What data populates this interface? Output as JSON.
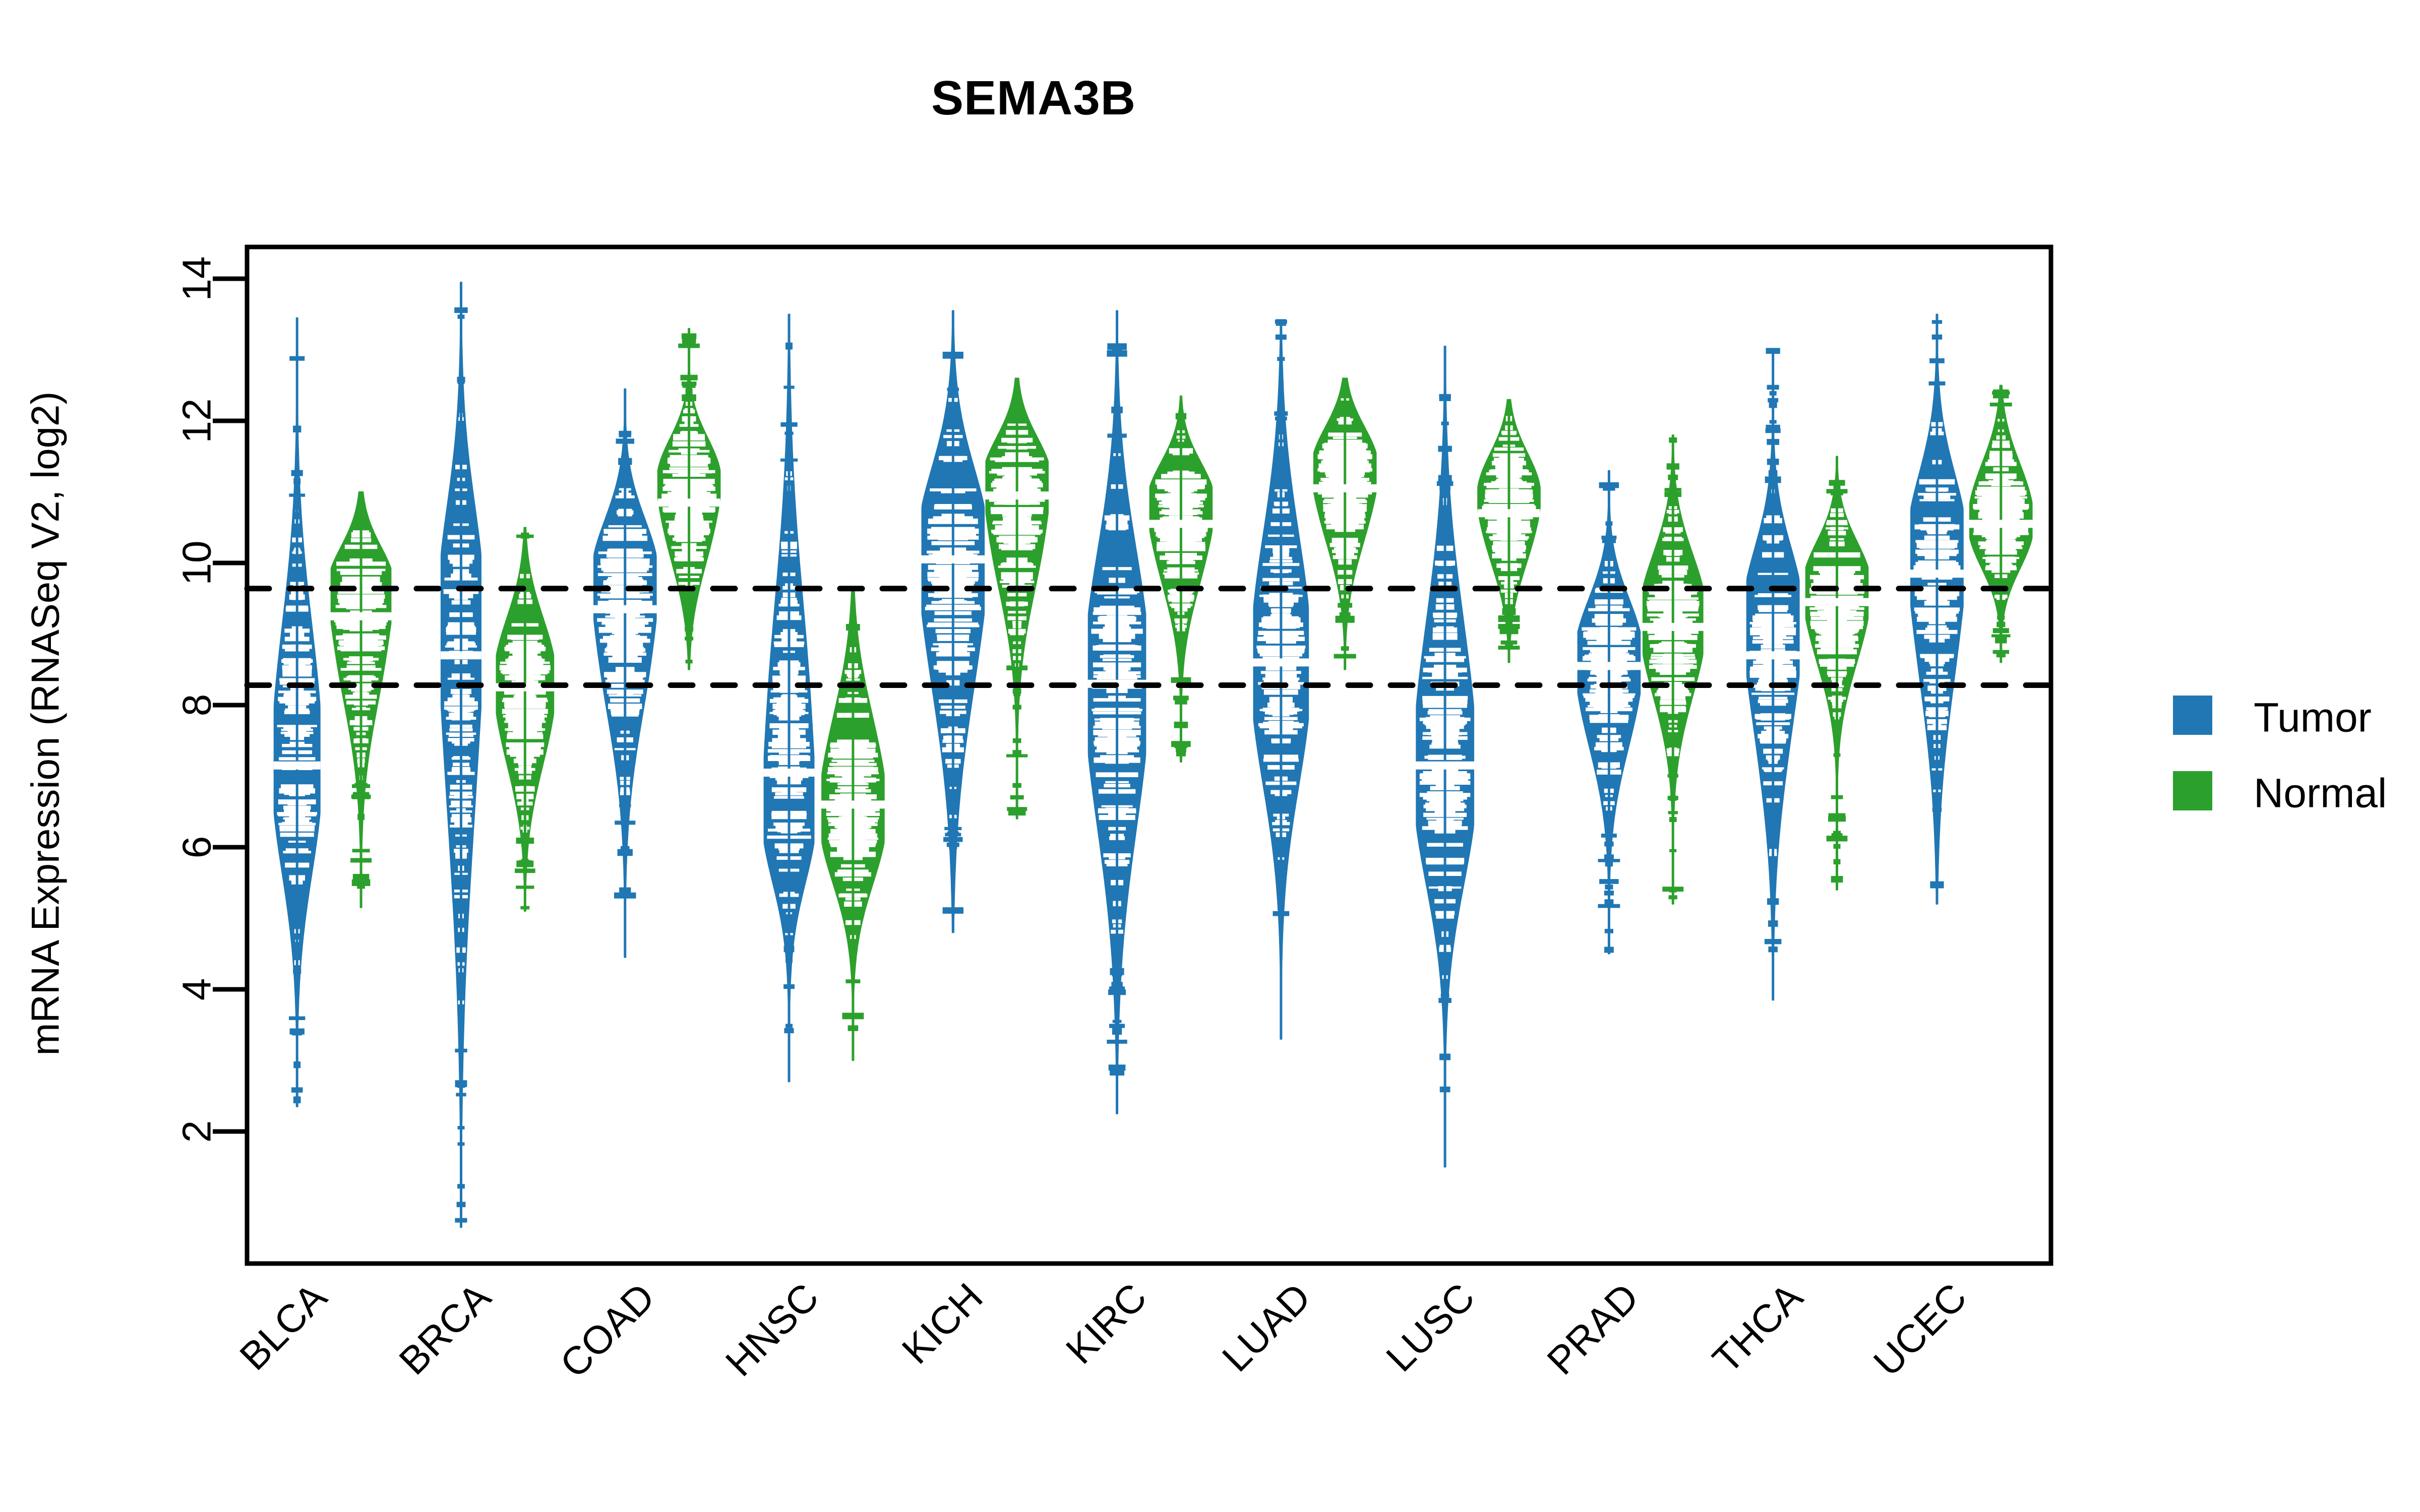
{
  "chart_data": {
    "type": "violin",
    "title": "SEMA3B",
    "xlabel": "",
    "ylabel": "mRNA Expression (RNASeq V2, log2)",
    "ylim": [
      0,
      14.6
    ],
    "yticks": [
      2,
      4,
      6,
      8,
      10,
      12,
      14
    ],
    "ytick_labels": [
      "2",
      "4",
      "6",
      "8",
      "10",
      "12",
      "14"
    ],
    "grid": false,
    "legend_position": "right",
    "reference_lines": [
      9.64,
      8.28
    ],
    "categories": [
      "BLCA",
      "BRCA",
      "COAD",
      "HNSC",
      "KICH",
      "KIRC",
      "LUAD",
      "LUSC",
      "PRAD",
      "THCA",
      "UCEC"
    ],
    "legend": [
      {
        "name": "Tumor",
        "color": "#2077B4"
      },
      {
        "name": "Normal",
        "color": "#2CA02C"
      }
    ],
    "series": [
      {
        "name": "Tumor",
        "color": "#2077B4",
        "groups": [
          {
            "category": "BLCA",
            "median": 7.15,
            "q1": 6.3,
            "q3": 8.4,
            "min": 2.35,
            "max": 13.45,
            "lower": 4.2,
            "upper": 11.0,
            "peak": 7.2,
            "width": 0.92,
            "seed": 11
          },
          {
            "category": "BRCA",
            "median": 8.7,
            "q1": 7.6,
            "q3": 9.7,
            "min": 0.65,
            "max": 13.95,
            "lower": 3.3,
            "upper": 12.4,
            "peak": 9.3,
            "width": 0.8,
            "seed": 23
          },
          {
            "category": "COAD",
            "median": 9.35,
            "q1": 8.5,
            "q3": 10.2,
            "min": 4.45,
            "max": 12.45,
            "lower": 6.5,
            "upper": 11.4,
            "peak": 9.7,
            "width": 1.25,
            "seed": 31
          },
          {
            "category": "HNSC",
            "median": 7.05,
            "q1": 6.0,
            "q3": 8.3,
            "min": 2.7,
            "max": 13.5,
            "lower": 4.6,
            "upper": 11.6,
            "peak": 6.6,
            "width": 1.0,
            "seed": 47
          },
          {
            "category": "KICH",
            "median": 10.05,
            "q1": 9.3,
            "q3": 10.7,
            "min": 4.8,
            "max": 13.55,
            "lower": 6.0,
            "upper": 12.4,
            "peak": 10.1,
            "width": 1.4,
            "seed": 53
          },
          {
            "category": "KIRC",
            "median": 8.3,
            "q1": 7.3,
            "q3": 9.3,
            "min": 2.25,
            "max": 13.55,
            "lower": 4.0,
            "upper": 12.0,
            "peak": 8.3,
            "width": 1.15,
            "seed": 61
          },
          {
            "category": "LUAD",
            "median": 8.6,
            "q1": 7.5,
            "q3": 9.6,
            "min": 3.3,
            "max": 13.4,
            "lower": 5.3,
            "upper": 12.2,
            "peak": 8.6,
            "width": 1.1,
            "seed": 73
          },
          {
            "category": "LUSC",
            "median": 7.15,
            "q1": 6.2,
            "q3": 8.3,
            "min": 1.5,
            "max": 13.05,
            "lower": 4.0,
            "upper": 11.3,
            "peak": 7.1,
            "width": 1.15,
            "seed": 83
          },
          {
            "category": "PRAD",
            "median": 8.55,
            "q1": 8.0,
            "q3": 9.2,
            "min": 4.5,
            "max": 11.3,
            "lower": 6.2,
            "upper": 10.2,
            "peak": 8.6,
            "width": 1.35,
            "seed": 97
          },
          {
            "category": "THCA",
            "median": 8.7,
            "q1": 8.1,
            "q3": 9.4,
            "min": 3.85,
            "max": 13.0,
            "lower": 5.6,
            "upper": 11.3,
            "peak": 9.3,
            "width": 1.05,
            "seed": 101
          },
          {
            "category": "UCEC",
            "median": 9.85,
            "q1": 9.1,
            "q3": 10.6,
            "min": 5.2,
            "max": 13.5,
            "lower": 6.4,
            "upper": 12.3,
            "peak": 10.2,
            "width": 1.05,
            "seed": 109
          }
        ]
      },
      {
        "name": "Normal",
        "color": "#2CA02C",
        "groups": [
          {
            "category": "BLCA",
            "median": 9.25,
            "q1": 8.7,
            "q3": 9.9,
            "min": 5.15,
            "max": 11.0,
            "lower": 6.8,
            "upper": 10.6,
            "peak": 9.6,
            "width": 1.2,
            "seed": 13
          },
          {
            "category": "BRCA",
            "median": 8.25,
            "q1": 7.6,
            "q3": 8.9,
            "min": 5.1,
            "max": 10.5,
            "lower": 6.1,
            "upper": 10.0,
            "peak": 8.3,
            "width": 1.15,
            "seed": 29
          },
          {
            "category": "COAD",
            "median": 10.85,
            "q1": 10.2,
            "q3": 11.5,
            "min": 8.5,
            "max": 13.3,
            "lower": 9.3,
            "upper": 12.3,
            "peak": 11.1,
            "width": 1.35,
            "seed": 37
          },
          {
            "category": "HNSC",
            "median": 6.6,
            "q1": 6.0,
            "q3": 7.5,
            "min": 3.0,
            "max": 9.6,
            "lower": 4.5,
            "upper": 9.0,
            "peak": 6.5,
            "width": 1.25,
            "seed": 43
          },
          {
            "category": "KICH",
            "median": 10.95,
            "q1": 10.3,
            "q3": 11.5,
            "min": 6.4,
            "max": 12.6,
            "lower": 8.4,
            "upper": 12.2,
            "peak": 11.1,
            "width": 1.4,
            "seed": 59
          },
          {
            "category": "KIRC",
            "median": 10.55,
            "q1": 10.0,
            "q3": 11.1,
            "min": 7.2,
            "max": 12.35,
            "lower": 8.8,
            "upper": 11.9,
            "peak": 10.8,
            "width": 1.35,
            "seed": 67
          },
          {
            "category": "LUAD",
            "median": 11.05,
            "q1": 10.5,
            "q3": 11.6,
            "min": 8.5,
            "max": 12.6,
            "lower": 9.5,
            "upper": 12.3,
            "peak": 11.3,
            "width": 1.3,
            "seed": 79
          },
          {
            "category": "LUSC",
            "median": 10.7,
            "q1": 10.1,
            "q3": 11.3,
            "min": 8.6,
            "max": 12.3,
            "lower": 9.4,
            "upper": 12.0,
            "peak": 10.9,
            "width": 1.3,
            "seed": 89
          },
          {
            "category": "PRAD",
            "median": 9.1,
            "q1": 8.6,
            "q3": 9.7,
            "min": 5.2,
            "max": 11.8,
            "lower": 7.0,
            "upper": 11.0,
            "peak": 9.2,
            "width": 1.2,
            "seed": 103
          },
          {
            "category": "THCA",
            "median": 9.45,
            "q1": 9.0,
            "q3": 10.0,
            "min": 5.4,
            "max": 11.5,
            "lower": 7.6,
            "upper": 10.9,
            "peak": 9.6,
            "width": 1.25,
            "seed": 107
          },
          {
            "category": "UCEC",
            "median": 10.55,
            "q1": 10.1,
            "q3": 11.1,
            "min": 8.6,
            "max": 12.5,
            "lower": 9.4,
            "upper": 12.1,
            "peak": 10.6,
            "width": 1.3,
            "seed": 113
          }
        ]
      }
    ]
  }
}
